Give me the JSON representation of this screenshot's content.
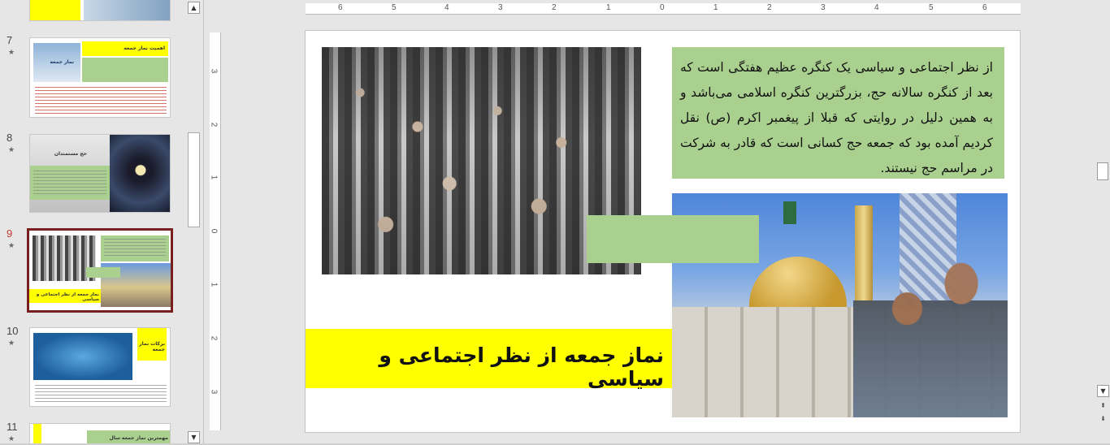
{
  "thumbnails": {
    "prev": {
      "star": "★"
    },
    "items": [
      {
        "num": "7",
        "star": "★",
        "title": "اهمیت نماز جمعه",
        "subtitle": "نماز جمعه"
      },
      {
        "num": "8",
        "star": "★",
        "title": "حج مستمندان"
      },
      {
        "num": "9",
        "star": "★",
        "title": "نماز جمعه از نظر اجتماعی و سیاسی"
      },
      {
        "num": "10",
        "star": "★",
        "title": "برکات نماز جمعه"
      },
      {
        "num": "11",
        "star": "★",
        "title": "مهمترین نماز جمعه سال"
      }
    ]
  },
  "ruler": {
    "horizontal": [
      "6",
      "5",
      "4",
      "3",
      "2",
      "1",
      "0",
      "1",
      "2",
      "3",
      "4",
      "5",
      "6"
    ],
    "vertical": [
      "3",
      "2",
      "1",
      "0",
      "1",
      "2",
      "3"
    ]
  },
  "slide": {
    "body_text": "از نظر اجتماعی و سیاسی یک کنگره عظیم هفتگی است که بعد از کنگره سالانه حج، بزرگترین کنگره اسلامی می‌باشد و به همین دلیل در روایتی که قبلا از پیغمبر اکرم (ص) نقل کردیم آمده بود که جمعه حج کسانی است که قادر به شرکت در مراسم حج نیستند.",
    "title": "نماز جمعه از نظر اجتماعی و سیاسی"
  },
  "scroll": {
    "up": "▲",
    "down": "▼",
    "prev_slide": "⇞",
    "next_slide": "⇟"
  },
  "colors": {
    "accent_green": "#a9d08e",
    "title_yellow": "#ffff00",
    "active_border": "#7a1f1f"
  }
}
